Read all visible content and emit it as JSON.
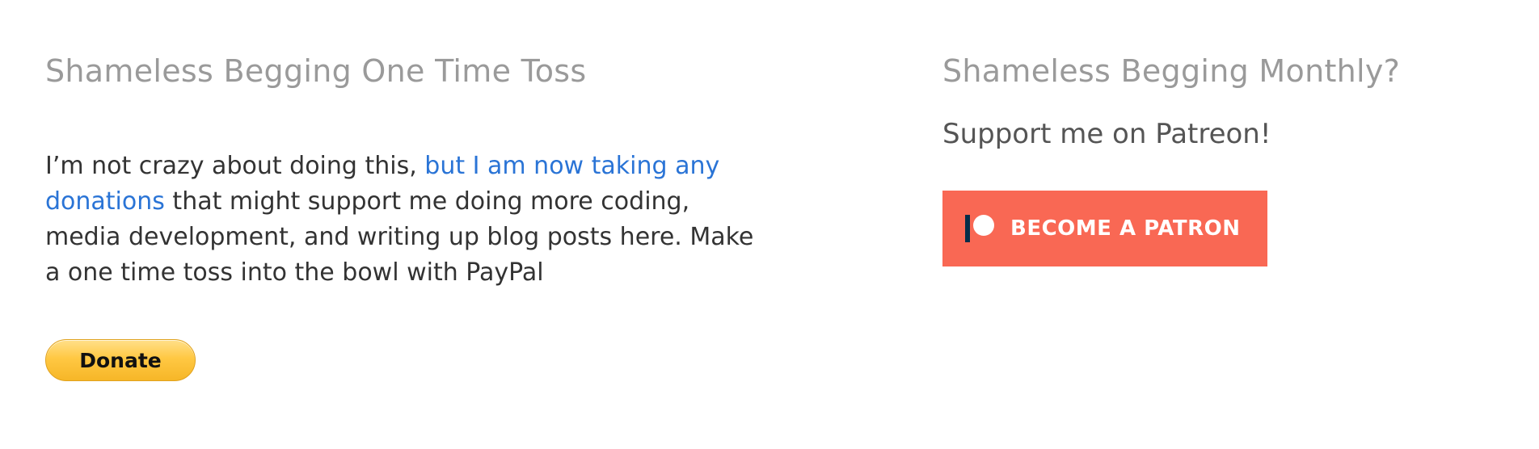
{
  "one_time": {
    "title": "Shameless Begging One Time Toss",
    "text_line1_plain": "I’m not crazy about doing this, ",
    "text_line1_link": "but I am now taking any",
    "text_line2_link": "donations",
    "text_line2_plain": " that might support me doing more coding,",
    "text_line3": "media development, and writing up blog posts here. Make",
    "text_line4": "a one time toss into the bowl with PayPal",
    "donate_label": "Donate"
  },
  "monthly": {
    "title": "Shameless Begging Monthly?",
    "subtitle": "Support me on Patreon!",
    "patron_label": "BECOME A PATRON",
    "patron_icon": "patreon-logo-icon"
  },
  "colors": {
    "heading": "#9a9a9a",
    "link": "#2a74d6",
    "paypal_button": "#ffc843",
    "patreon_button": "#f96854"
  }
}
